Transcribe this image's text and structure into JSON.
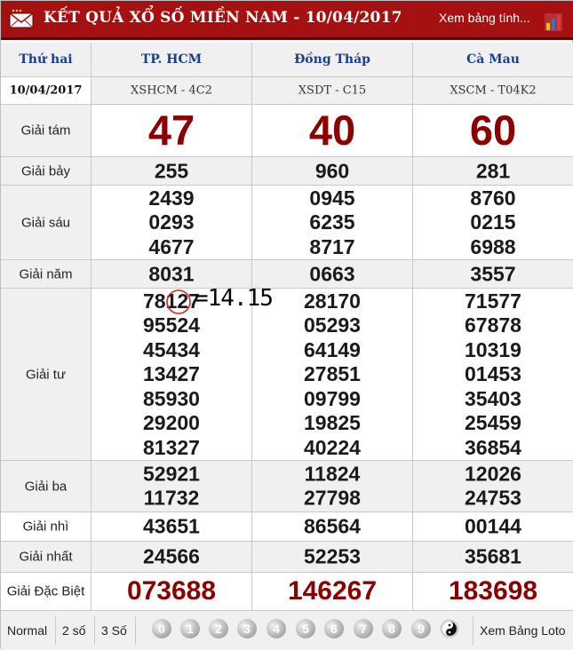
{
  "header": {
    "title": "KẾT QUẢ XỔ SỐ MIỀN NAM - 10/04/2017",
    "view_link": "Xem bảng tính...",
    "colors": {
      "bar": "#a51010",
      "number": "#8b0000",
      "province": "#1a3f8f"
    }
  },
  "table": {
    "day": "Thứ hai",
    "date": "10/04/2017",
    "provinces": [
      {
        "name": "TP. HCM",
        "code": "XSHCM - 4C2"
      },
      {
        "name": "Đồng Tháp",
        "code": "XSDT - C15"
      },
      {
        "name": "Cà Mau",
        "code": "XSCM - T04K2"
      }
    ],
    "prizes": {
      "g8": {
        "label": "Giải tám",
        "values": [
          "47",
          "40",
          "60"
        ]
      },
      "g7": {
        "label": "Giải bảy",
        "values": [
          "255",
          "960",
          "281"
        ]
      },
      "g6": {
        "label": "Giải sáu",
        "values": [
          [
            "2439",
            "0293",
            "4677"
          ],
          [
            "0945",
            "6235",
            "8717"
          ],
          [
            "8760",
            "0215",
            "6988"
          ]
        ]
      },
      "g5": {
        "label": "Giải năm",
        "values": [
          "8031",
          "0663",
          "3557"
        ]
      },
      "g4": {
        "label": "Giải tư",
        "values": [
          [
            "78127",
            "95524",
            "45434",
            "13427",
            "85930",
            "29200",
            "81327"
          ],
          [
            "28170",
            "05293",
            "64149",
            "27851",
            "09799",
            "19825",
            "40224"
          ],
          [
            "71577",
            "67878",
            "10319",
            "01453",
            "35403",
            "25459",
            "36854"
          ]
        ]
      },
      "g3": {
        "label": "Giải ba",
        "values": [
          [
            "52921",
            "11732"
          ],
          [
            "11824",
            "27798"
          ],
          [
            "12026",
            "24753"
          ]
        ]
      },
      "g2": {
        "label": "Giải nhì",
        "values": [
          "43651",
          "86564",
          "00144"
        ]
      },
      "g1": {
        "label": "Giải nhất",
        "values": [
          "24566",
          "52253",
          "35681"
        ]
      },
      "db": {
        "label": "Giải Đặc Biệt",
        "values": [
          "073688",
          "146267",
          "183698"
        ]
      }
    }
  },
  "footer": {
    "normal": "Normal",
    "two_digits": "2 số",
    "three_digits": "3 Số",
    "balls": [
      "0",
      "1",
      "2",
      "3",
      "4",
      "5",
      "6",
      "7",
      "8",
      "9"
    ],
    "all_icon": "yin-yang-icon",
    "loto_link": "Xem Bảng Loto"
  },
  "annotation": {
    "text": "=14.15",
    "circled_digits": "12"
  }
}
